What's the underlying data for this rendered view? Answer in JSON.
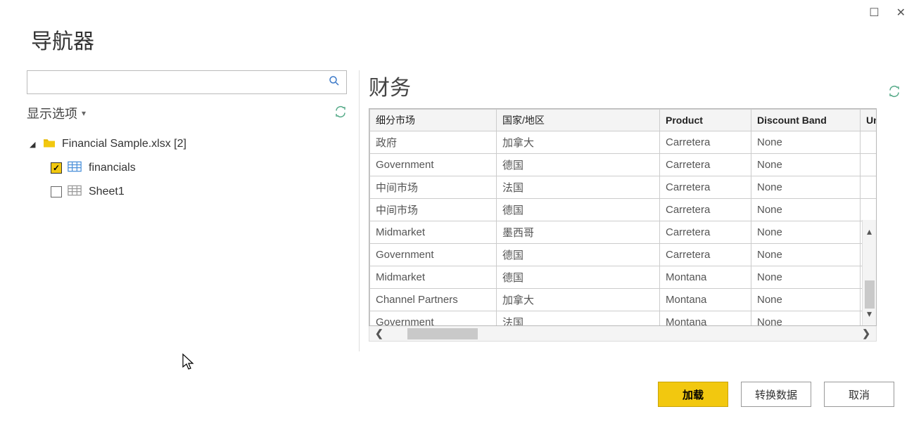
{
  "dialog": {
    "title": "导航器"
  },
  "search": {
    "placeholder": ""
  },
  "display_options": {
    "label": "显示选项"
  },
  "tree": {
    "root": {
      "label": "Financial Sample.xlsx [2]"
    },
    "items": [
      {
        "label": "financials",
        "checked": true,
        "type": "table"
      },
      {
        "label": "Sheet1",
        "checked": false,
        "type": "sheet"
      }
    ]
  },
  "preview": {
    "title": "财务",
    "columns": [
      "细分市场",
      "国家/地区",
      "Product",
      "Discount Band",
      "Uni"
    ],
    "rows": [
      [
        "政府",
        "加拿大",
        "Carretera",
        "None"
      ],
      [
        "Government",
        "德国",
        "Carretera",
        "None"
      ],
      [
        "中间市场",
        "法国",
        "Carretera",
        "None"
      ],
      [
        "中间市场",
        "德国",
        "Carretera",
        "None"
      ],
      [
        "Midmarket",
        "墨西哥",
        "Carretera",
        "None"
      ],
      [
        "Government",
        "德国",
        "Carretera",
        "None"
      ],
      [
        "Midmarket",
        "德国",
        "Montana",
        "None"
      ],
      [
        "Channel Partners",
        "加拿大",
        "Montana",
        "None"
      ],
      [
        "Government",
        "法国",
        "Montana",
        "None"
      ]
    ]
  },
  "buttons": {
    "load": "加载",
    "transform": "转换数据",
    "cancel": "取消"
  }
}
